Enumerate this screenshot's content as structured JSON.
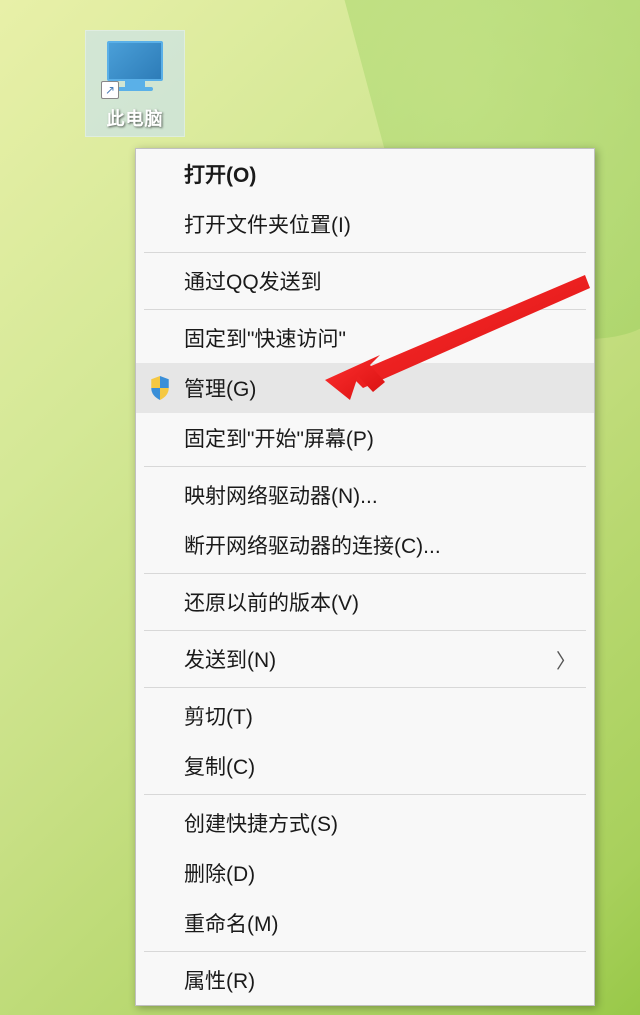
{
  "desktop": {
    "icon_label": "此电脑"
  },
  "context_menu": {
    "items": [
      {
        "label": "打开(O)",
        "bold": true
      },
      {
        "label": "打开文件夹位置(I)"
      },
      {
        "separator": true
      },
      {
        "label": "通过QQ发送到"
      },
      {
        "separator": true
      },
      {
        "label": "固定到\"快速访问\""
      },
      {
        "label": "管理(G)",
        "icon": "shield",
        "highlighted": true
      },
      {
        "label": "固定到\"开始\"屏幕(P)"
      },
      {
        "separator": true
      },
      {
        "label": "映射网络驱动器(N)..."
      },
      {
        "label": "断开网络驱动器的连接(C)..."
      },
      {
        "separator": true
      },
      {
        "label": "还原以前的版本(V)"
      },
      {
        "separator": true
      },
      {
        "label": "发送到(N)",
        "submenu": true
      },
      {
        "separator": true
      },
      {
        "label": "剪切(T)"
      },
      {
        "label": "复制(C)"
      },
      {
        "separator": true
      },
      {
        "label": "创建快捷方式(S)"
      },
      {
        "label": "删除(D)"
      },
      {
        "label": "重命名(M)"
      },
      {
        "separator": true
      },
      {
        "label": "属性(R)"
      }
    ]
  }
}
